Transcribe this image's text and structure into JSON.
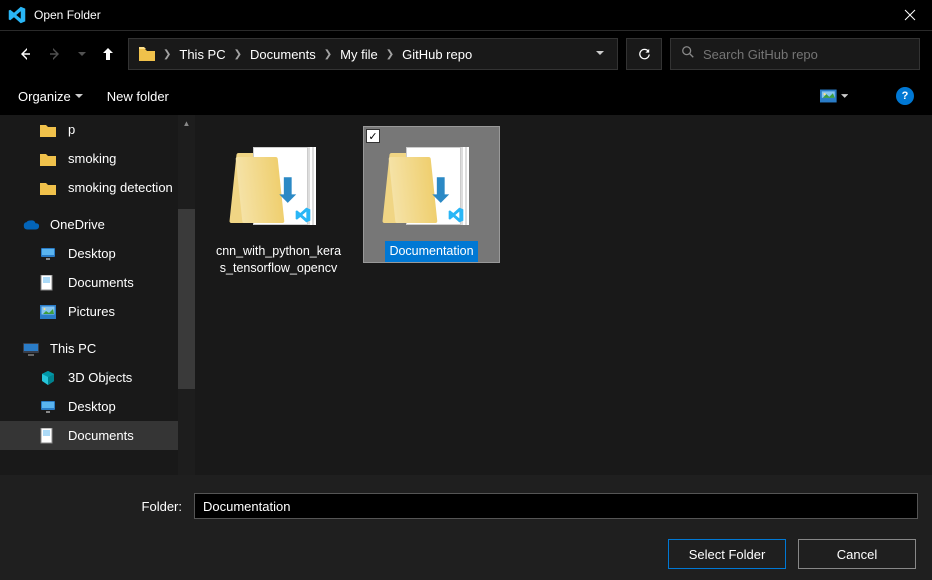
{
  "window": {
    "title": "Open Folder"
  },
  "breadcrumb": {
    "items": [
      "This PC",
      "Documents",
      "My file",
      "GitHub repo"
    ]
  },
  "search": {
    "placeholder": "Search GitHub repo"
  },
  "toolbar": {
    "organize": "Organize",
    "new_folder": "New folder",
    "help": "?"
  },
  "sidebar": {
    "recent": [
      {
        "name": "p"
      },
      {
        "name": "smoking"
      },
      {
        "name": "smoking detection"
      }
    ],
    "onedrive": {
      "name": "OneDrive",
      "children": [
        {
          "name": "Desktop",
          "icon": "monitor"
        },
        {
          "name": "Documents",
          "icon": "doc"
        },
        {
          "name": "Pictures",
          "icon": "picture"
        }
      ]
    },
    "thispc": {
      "name": "This PC",
      "children": [
        {
          "name": "3D Objects",
          "icon": "3d"
        },
        {
          "name": "Desktop",
          "icon": "monitor"
        },
        {
          "name": "Documents",
          "icon": "doc",
          "active": true
        }
      ]
    }
  },
  "files": [
    {
      "name": "cnn_with_python_keras_tensorflow_opencv",
      "selected": false
    },
    {
      "name": "Documentation",
      "selected": true
    }
  ],
  "footer": {
    "label": "Folder:",
    "value": "Documentation",
    "select": "Select Folder",
    "cancel": "Cancel"
  }
}
